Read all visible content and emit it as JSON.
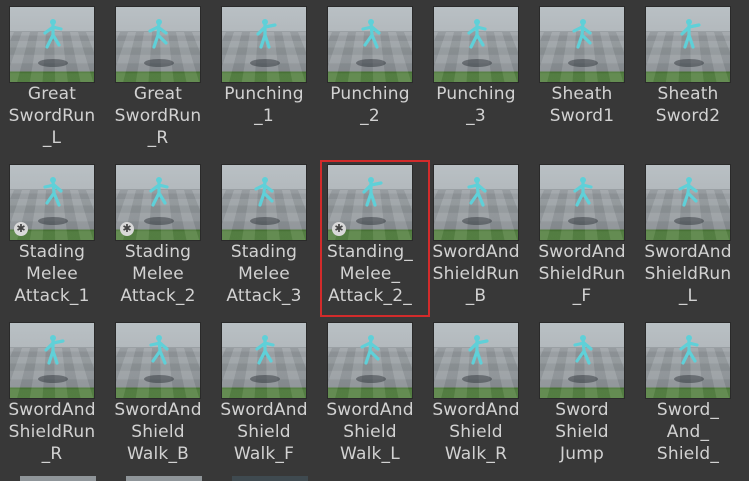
{
  "assets": [
    {
      "label": "Great\nSwordRun\n_L",
      "badge": false
    },
    {
      "label": "Great\nSwordRun\n_R",
      "badge": false
    },
    {
      "label": "Punching\n_1",
      "badge": false
    },
    {
      "label": "Punching\n_2",
      "badge": false
    },
    {
      "label": "Punching\n_3",
      "badge": false
    },
    {
      "label": "Sheath\nSword1",
      "badge": false
    },
    {
      "label": "Sheath\nSword2",
      "badge": false
    },
    {
      "label": "Stading\nMelee\nAttack_1",
      "badge": true
    },
    {
      "label": "Stading\nMelee\nAttack_2",
      "badge": true
    },
    {
      "label": "Stading\nMelee\nAttack_3",
      "badge": false
    },
    {
      "label": "Standing_\nMelee_\nAttack_2_",
      "badge": true,
      "selected": true
    },
    {
      "label": "SwordAnd\nShieldRun\n_B",
      "badge": false
    },
    {
      "label": "SwordAnd\nShieldRun\n_F",
      "badge": false
    },
    {
      "label": "SwordAnd\nShieldRun\n_L",
      "badge": false
    },
    {
      "label": "SwordAnd\nShieldRun\n_R",
      "badge": false
    },
    {
      "label": "SwordAnd\nShield\nWalk_B",
      "badge": false
    },
    {
      "label": "SwordAnd\nShield\nWalk_F",
      "badge": false
    },
    {
      "label": "SwordAnd\nShield\nWalk_L",
      "badge": false
    },
    {
      "label": "SwordAnd\nShield\nWalk_R",
      "badge": false
    },
    {
      "label": "Sword\nShield\nJump",
      "badge": false
    },
    {
      "label": "Sword_\nAnd_\nShield_",
      "badge": false
    }
  ],
  "badge_icon": "gear-icon",
  "colors": {
    "background": "#383838",
    "label": "#d2d2d2",
    "selection": "#d22b2b",
    "figure": "#5fd0d8",
    "ground_strip": "#4f7d3b"
  }
}
